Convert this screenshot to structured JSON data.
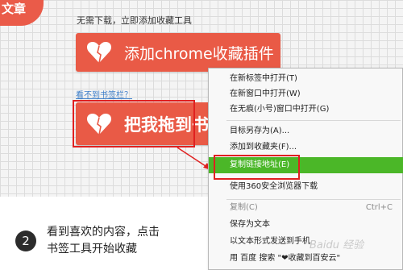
{
  "corner_tab": "文章",
  "intro_text": "无需下载，立即添加收藏工具",
  "chrome_button": "添加chrome收藏插件",
  "no_bookmark_bar_link": "看不到书签栏？",
  "drag_button": "把我拖到书",
  "step": {
    "number": "2",
    "line1": "看到喜欢的内容，点击",
    "line2": "书签工具开始收藏"
  },
  "context_menu": {
    "items": [
      {
        "label": "在新标签中打开(T)",
        "state": "normal"
      },
      {
        "label": "在新窗口中打开(W)",
        "state": "normal"
      },
      {
        "label": "在无痕(小号)窗口中打开(G)",
        "state": "normal"
      },
      {
        "label": "目标另存为(A)...",
        "state": "normal"
      },
      {
        "label": "添加到收藏夹(F)...",
        "state": "normal"
      },
      {
        "label": "复制链接地址(E)",
        "state": "active"
      },
      {
        "label": "使用360安全浏览器下载",
        "state": "normal"
      },
      {
        "label": "复制(C)",
        "state": "disabled",
        "shortcut": "Ctrl+C"
      },
      {
        "label": "保存为文本",
        "state": "normal"
      },
      {
        "label": "以文本形式发送到手机",
        "state": "normal"
      },
      {
        "label": "用 百度 搜索 \"❤收藏到百安云\"",
        "state": "normal"
      }
    ]
  },
  "watermark": "Baidu 经验",
  "colors": {
    "button_red": "#e95a46",
    "highlight_red": "#e02020",
    "menu_active_green": "#4bb728"
  }
}
